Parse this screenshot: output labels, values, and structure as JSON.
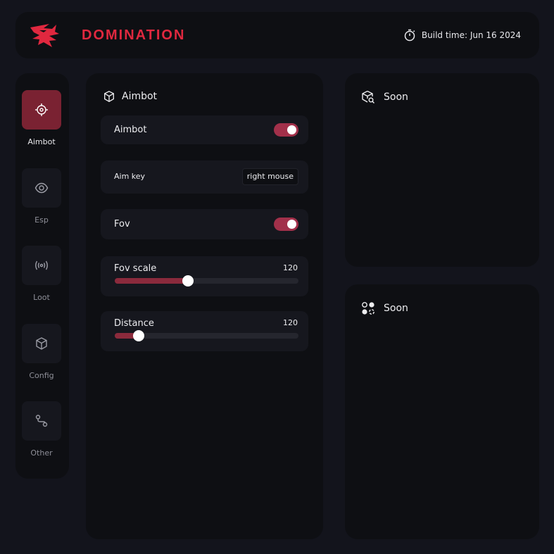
{
  "header": {
    "brand": "DOMINATION",
    "build_time": "Build time: Jun 16 2024",
    "accent_color": "#e0283f",
    "logo_icon": "shark-icon",
    "build_icon": "stopwatch-icon"
  },
  "sidebar": {
    "items": [
      {
        "label": "Aimbot",
        "icon": "crosshair-icon",
        "active": true
      },
      {
        "label": "Esp",
        "icon": "eye-icon",
        "active": false
      },
      {
        "label": "Loot",
        "icon": "radio-signal-icon",
        "active": false
      },
      {
        "label": "Config",
        "icon": "cube-icon",
        "active": false
      },
      {
        "label": "Other",
        "icon": "route-icon",
        "active": false
      }
    ],
    "active_color": "#7a2232"
  },
  "main": {
    "title": "Aimbot",
    "title_icon": "cube-icon",
    "aimbot_toggle": {
      "label": "Aimbot",
      "on": true
    },
    "aim_key": {
      "label": "Aim key",
      "value": "right mouse"
    },
    "fov_toggle": {
      "label": "Fov",
      "on": true
    },
    "fov_scale": {
      "label": "Fov scale",
      "value": "120",
      "fraction": 0.4
    },
    "distance": {
      "label": "Distance",
      "value": "120",
      "fraction": 0.13
    }
  },
  "panels": {
    "soon_top": {
      "title": "Soon",
      "icon": "cube-search-icon"
    },
    "soon_bottom": {
      "title": "Soon",
      "icon": "shapes-icon"
    }
  }
}
